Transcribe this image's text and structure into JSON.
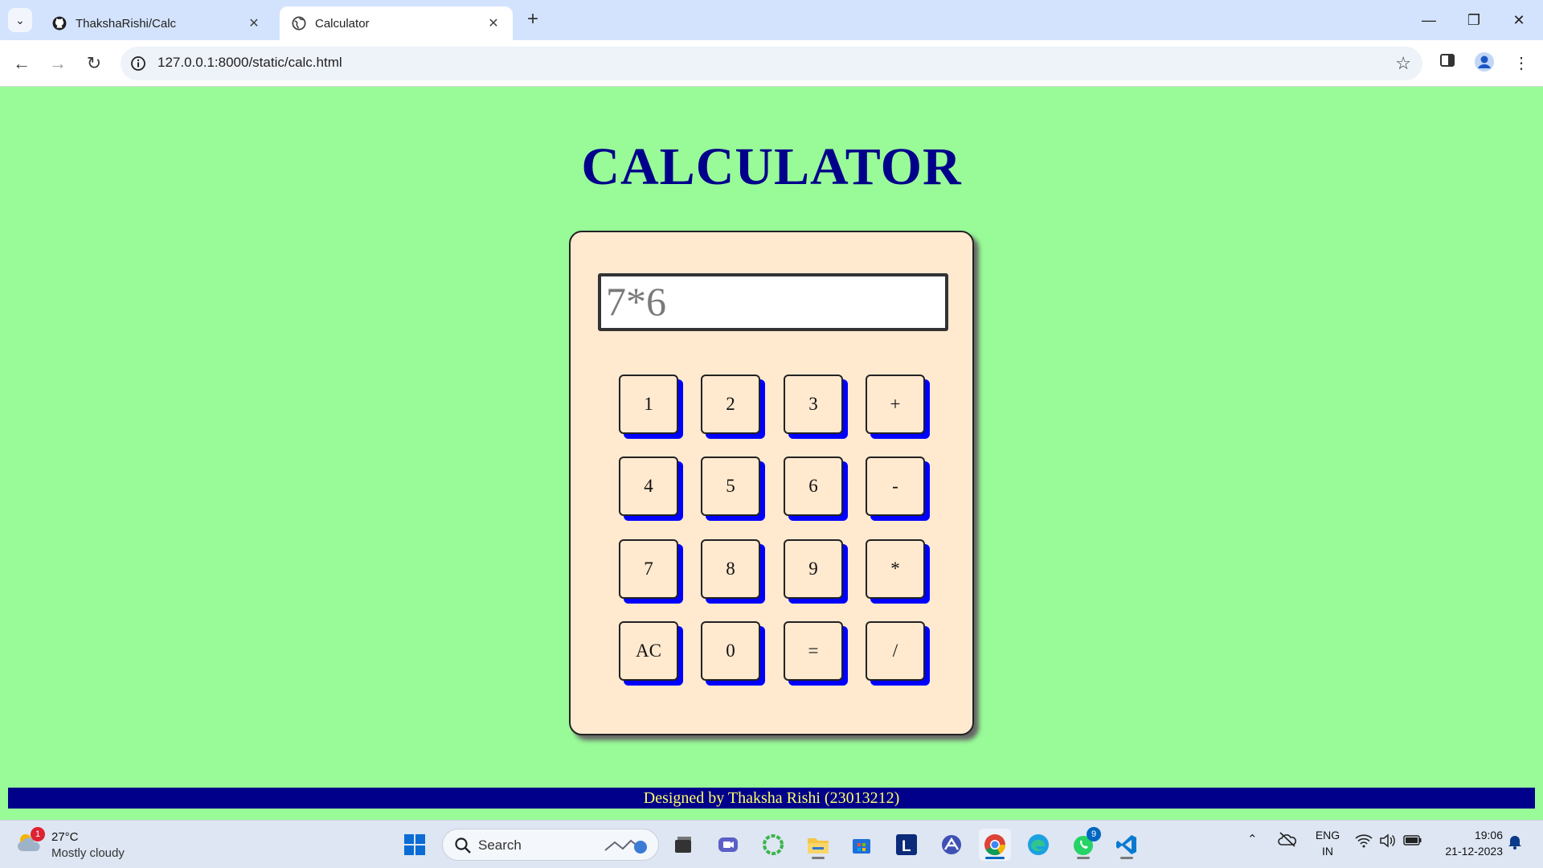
{
  "browser": {
    "tabs": [
      {
        "title": "ThakshaRishi/Calc",
        "icon": "github-icon"
      },
      {
        "title": "Calculator",
        "icon": "globe-icon"
      }
    ],
    "url": "127.0.0.1:8000/static/calc.html"
  },
  "page": {
    "title": "CALCULATOR",
    "display_value": "7*6",
    "keys": [
      "1",
      "2",
      "3",
      "+",
      "4",
      "5",
      "6",
      "-",
      "7",
      "8",
      "9",
      "*",
      "AC",
      "0",
      "=",
      "/"
    ],
    "footer": "Designed by Thaksha Rishi (23013212)"
  },
  "taskbar": {
    "weather": {
      "temp": "27°C",
      "condition": "Mostly cloudy",
      "badge": "1"
    },
    "search_label": "Search",
    "whatsapp_badge": "9",
    "lang": [
      "ENG",
      "IN"
    ],
    "time": "19:06",
    "date": "21-12-2023"
  },
  "colors": {
    "page_bg": "#98fb98",
    "title": "#00008b",
    "calc_bg": "#ffe9cf",
    "key_shadow": "#0000ff",
    "footer_bg": "#00008b",
    "footer_text": "#ffff66"
  }
}
